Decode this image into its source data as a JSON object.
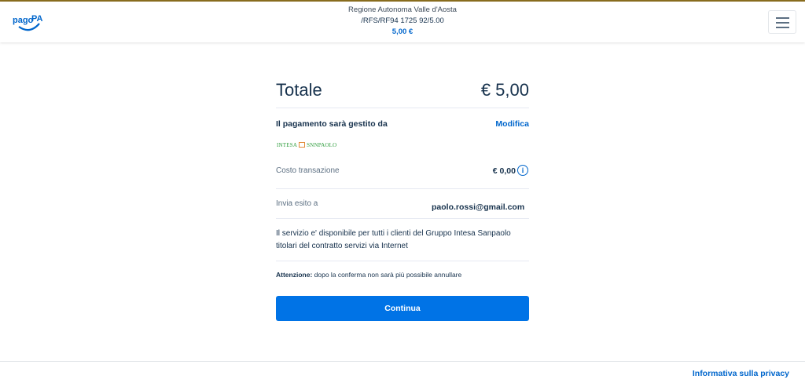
{
  "app": {
    "logo_text": "pagoPA"
  },
  "header": {
    "beneficiary": "Regione Autonoma Valle d'Aosta",
    "reference": "/RFS/RF94 1725 92/5.00",
    "amount": "5,00 €"
  },
  "summary": {
    "total_label": "Totale",
    "total_amount": "€ 5,00",
    "managed_by_label": "Il pagamento sarà gestito da",
    "modify_label": "Modifica",
    "bank_name_left": "INTESA",
    "bank_name_right": "SNNPAOLO",
    "cost_label": "Costo transazione",
    "cost_value": "€ 0,00",
    "info_icon_glyph": "i",
    "send_to_label": "Invia esito a",
    "send_to_email": "paolo.rossi@gmail.com",
    "description": "Il servizio e' disponibile per tutti i clienti del Gruppo Intesa Sanpaolo titolari del contratto servizi via Internet",
    "warning_bold": "Attenzione:",
    "warning_text": " dopo la conferma non sarà più possibile annullare",
    "continue_label": "Continua"
  },
  "footer": {
    "privacy_label": "Informativa sulla privacy"
  },
  "colors": {
    "accent": "#0073e6",
    "link": "#0066cc",
    "text": "#17324d",
    "bank_green": "#2c9c3b"
  }
}
